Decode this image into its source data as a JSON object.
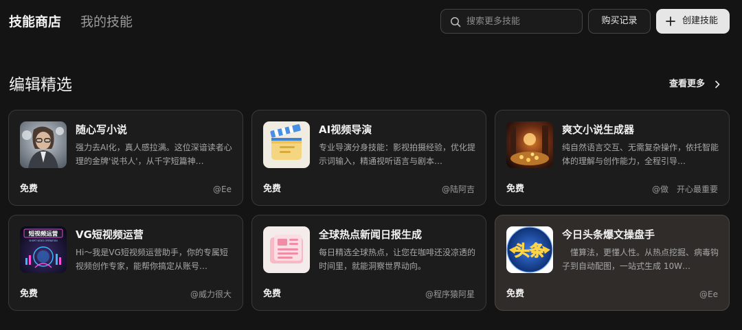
{
  "tabs": [
    {
      "label": "技能商店",
      "active": true
    },
    {
      "label": "我的技能",
      "active": false
    }
  ],
  "search": {
    "placeholder": "搜索更多技能",
    "value": ""
  },
  "buttons": {
    "history": "购买记录",
    "create": "创建技能"
  },
  "section": {
    "title": "编辑精选",
    "more": "查看更多"
  },
  "cards": [
    {
      "title": "随心写小说",
      "desc": "强力去AI化，真人感拉满。这位深谙读者心理的金牌'说书人'，从千字短篇神…",
      "price": "免费",
      "author": "@Ee"
    },
    {
      "title": "AI视频导演",
      "desc": "专业导演分身技能：影视拍摄经验，优化提示词输入，精通视听语言与剧本…",
      "price": "免费",
      "author": "@陆阿吉"
    },
    {
      "title": "爽文小说生成器",
      "desc": "纯自然语言交互、无需复杂操作，依托智能体的理解与创作能力，全程引导…",
      "price": "免费",
      "author": "@做　开心最重要"
    },
    {
      "title": "VG短视频运营",
      "desc": "Hi～我是VG短视频运营助手，你的专属短视频创作专家，能帮你搞定从账号…",
      "price": "免费",
      "author": "@威力很大"
    },
    {
      "title": "全球热点新闻日报生成",
      "desc": "每日精选全球热点，让您在咖啡还没凉透的时间里，就能洞察世界动向。",
      "price": "免费",
      "author": "@程序猿阿星"
    },
    {
      "title": "今日头条爆文操盘手",
      "desc": "　懂算法，更懂人性。从热点挖掘、病毒钩子到自动配图，一站式生成 10W…",
      "price": "免费",
      "author": "@Ee"
    }
  ],
  "thumbs": {
    "vg_text": "短视频运营",
    "vg_sub": "SHORT VIDEO OPERATION",
    "toutiao_text": "头条"
  },
  "colors": {
    "background": "#141414",
    "card_bg": "#1c1c1c",
    "card_highlight_bg": "#2f2c29",
    "create_button_bg": "#e6e6e6"
  },
  "icons": [
    "search-icon",
    "plus-icon",
    "chevron-right-icon"
  ]
}
